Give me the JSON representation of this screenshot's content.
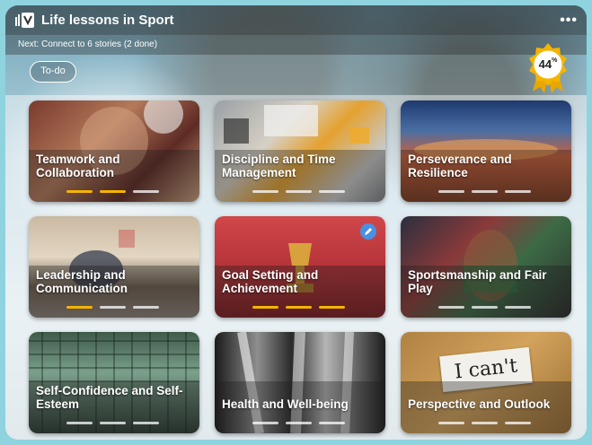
{
  "header": {
    "title": "Life lessons in Sport",
    "more_label": "•••",
    "app_icon": "app-logo-icon"
  },
  "subheader": {
    "text": "Next: Connect to 6 stories (2 done)"
  },
  "todo_button": {
    "label": "To-do"
  },
  "progress_badge": {
    "value": "44",
    "unit": "%",
    "color": "#f4b400"
  },
  "colors": {
    "accent": "#f4b400",
    "edit": "#4a90e2"
  },
  "cards": [
    {
      "label": "Teamwork and Collaboration",
      "segments_done": 2,
      "segments_total": 3
    },
    {
      "label": "Discipline and Time Management",
      "segments_done": 0,
      "segments_total": 3
    },
    {
      "label": "Perseverance and Resilience",
      "segments_done": 0,
      "segments_total": 3
    },
    {
      "label": "Leadership and Communication",
      "segments_done": 1,
      "segments_total": 3
    },
    {
      "label": "Goal Setting and Achievement",
      "segments_done": 3,
      "segments_total": 3,
      "editable": true
    },
    {
      "label": "Sportsmanship and Fair Play",
      "segments_done": 0,
      "segments_total": 3
    },
    {
      "label": "Self-Confidence and Self-Esteem",
      "segments_done": 0,
      "segments_total": 3
    },
    {
      "label": "Health and Well-being",
      "segments_done": 0,
      "segments_total": 3
    },
    {
      "label": "Perspective and Outlook",
      "segments_done": 0,
      "segments_total": 3
    }
  ],
  "card9_sign": {
    "text": "I can't"
  }
}
